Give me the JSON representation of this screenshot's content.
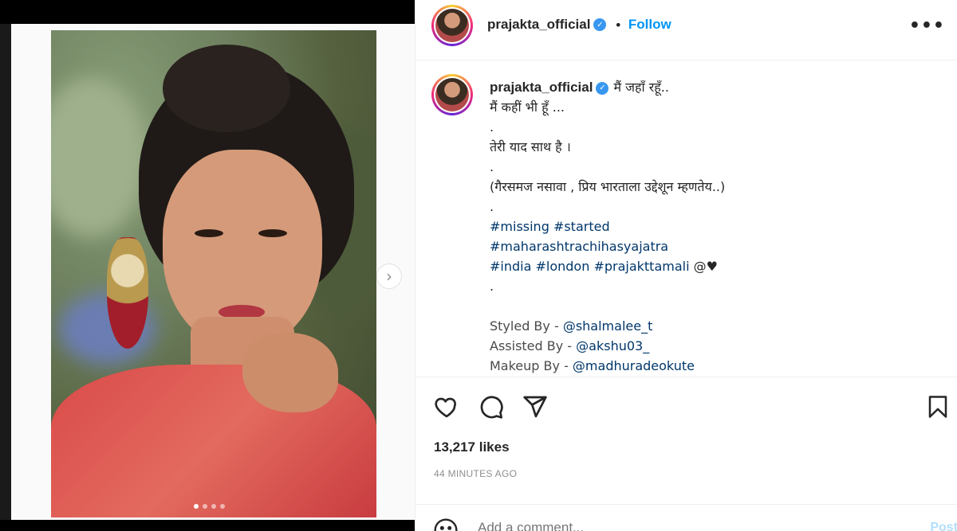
{
  "post": {
    "username": "prajakta_official",
    "follow_label": "Follow",
    "separator": "•",
    "more_label": "•••",
    "verified_glyph": "✓",
    "next_glyph": "›"
  },
  "caption": {
    "lines": [
      {
        "type": "first",
        "text": "मैं जहाँ रहूँ.."
      },
      {
        "type": "text",
        "text": "मैं कहीं भी हूँ ..."
      },
      {
        "type": "text",
        "text": "."
      },
      {
        "type": "text",
        "text": "तेरी याद साथ है ।"
      },
      {
        "type": "text",
        "text": "."
      },
      {
        "type": "text",
        "text": "(गैरसमज नसावा , प्रिय भारताला उद्देशून म्हणतेय..)"
      },
      {
        "type": "text",
        "text": "."
      },
      {
        "type": "tags",
        "text": "#missing #started"
      },
      {
        "type": "tags",
        "text": "#maharashtrachihasyajatra"
      },
      {
        "type": "mixed",
        "tags": "#india #london #prajakttamali",
        "tail": " @♥"
      },
      {
        "type": "text",
        "text": "."
      },
      {
        "type": "text",
        "text": ""
      },
      {
        "type": "credit",
        "label": "Styled By - ",
        "handle": "@shalmalee_t"
      },
      {
        "type": "credit",
        "label": "Assisted By - ",
        "handle": "@akshu03_"
      },
      {
        "type": "credit",
        "label": "Makeup By - ",
        "handle": "@madhuradeokute"
      }
    ]
  },
  "stats": {
    "likes": "13,217 likes",
    "time": "44 MINUTES AGO"
  },
  "comment": {
    "placeholder": "Add a comment...",
    "post_label": "Post"
  },
  "icons": {
    "like": "heart-icon",
    "comment": "comment-icon",
    "share": "paper-plane-icon",
    "save": "bookmark-icon",
    "emoji": "emoji-icon",
    "next": "chevron-right-icon"
  },
  "colors": {
    "link": "#00376b",
    "follow": "#0095f6",
    "verified": "#3897f0",
    "muted": "#8e8e8e"
  },
  "carousel": {
    "slides": 4,
    "active": 1
  }
}
